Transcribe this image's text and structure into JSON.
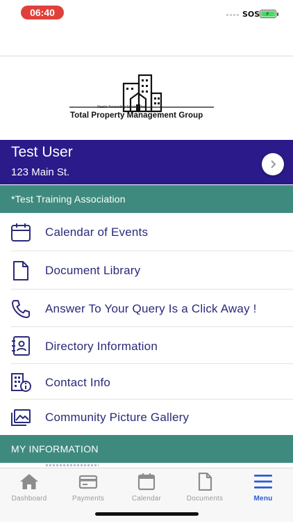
{
  "status_bar": {
    "time": "06:40",
    "carrier": "SOS",
    "battery_color": "#4cd964"
  },
  "logo": {
    "caption": "Realor Accounting Services Inc.",
    "title": "Total Property Management Group"
  },
  "user": {
    "name": "Test User",
    "address": "123 Main St."
  },
  "association": {
    "label": "*Test Training Association"
  },
  "menu": {
    "items": [
      {
        "label": "Calendar of Events",
        "icon": "calendar-icon"
      },
      {
        "label": "Document Library",
        "icon": "document-icon"
      },
      {
        "label": "Answer To Your Query Is a Click Away !",
        "icon": "phone-icon"
      },
      {
        "label": "Directory Information",
        "icon": "contact-book-icon"
      },
      {
        "label": "Contact Info",
        "icon": "building-info-icon"
      },
      {
        "label": "Community Picture Gallery",
        "icon": "gallery-icon"
      }
    ]
  },
  "my_information": {
    "label": "MY INFORMATION"
  },
  "tabs": [
    {
      "label": "Dashboard",
      "icon": "home-icon",
      "active": false
    },
    {
      "label": "Payments",
      "icon": "payment-card-icon",
      "active": false
    },
    {
      "label": "Calendar",
      "icon": "calendar-icon",
      "active": false
    },
    {
      "label": "Documents",
      "icon": "document-icon",
      "active": false
    },
    {
      "label": "Menu",
      "icon": "hamburger-menu-icon",
      "active": true
    }
  ],
  "colors": {
    "header_purple": "#2a1a8a",
    "section_teal": "#3f8a7f",
    "menu_text": "#2a2a7a",
    "active_tab": "#2a5ad8",
    "time_pill": "#e0403a"
  }
}
